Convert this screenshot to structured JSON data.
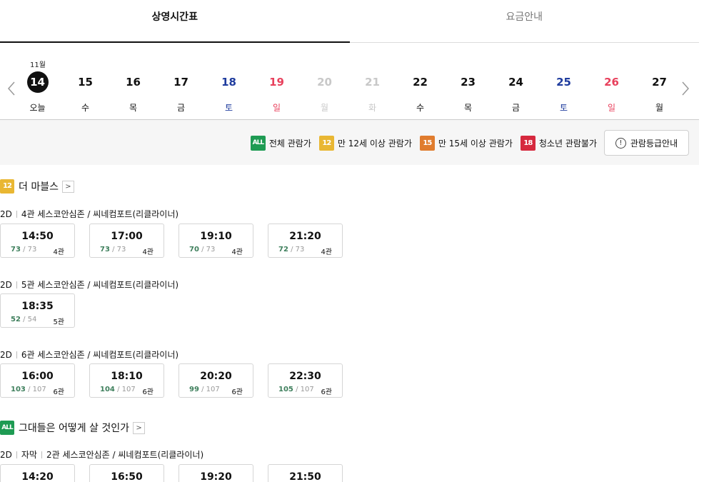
{
  "tabs": [
    {
      "label": "상영시간표",
      "active": true
    },
    {
      "label": "요금안내",
      "active": false
    }
  ],
  "calendar": {
    "month": "11월",
    "days": [
      {
        "num": "14",
        "weekday": "오늘",
        "type": "today"
      },
      {
        "num": "15",
        "weekday": "수",
        "type": "normal"
      },
      {
        "num": "16",
        "weekday": "목",
        "type": "normal"
      },
      {
        "num": "17",
        "weekday": "금",
        "type": "normal"
      },
      {
        "num": "18",
        "weekday": "토",
        "type": "sat"
      },
      {
        "num": "19",
        "weekday": "일",
        "type": "sun"
      },
      {
        "num": "20",
        "weekday": "월",
        "type": "dis"
      },
      {
        "num": "21",
        "weekday": "화",
        "type": "dis"
      },
      {
        "num": "22",
        "weekday": "수",
        "type": "normal"
      },
      {
        "num": "23",
        "weekday": "목",
        "type": "normal"
      },
      {
        "num": "24",
        "weekday": "금",
        "type": "normal"
      },
      {
        "num": "25",
        "weekday": "토",
        "type": "sat"
      },
      {
        "num": "26",
        "weekday": "일",
        "type": "sun"
      },
      {
        "num": "27",
        "weekday": "월",
        "type": "normal"
      }
    ]
  },
  "ratings": {
    "items": [
      {
        "badge": "ALL",
        "label": "전체 관람가",
        "color": "#1e9b53"
      },
      {
        "badge": "12",
        "label": "만 12세 이상 관람가",
        "color": "#e9b733"
      },
      {
        "badge": "15",
        "label": "만 15세 이상 관람가",
        "color": "#e07c2e"
      },
      {
        "badge": "18",
        "label": "청소년 관람불가",
        "color": "#d6293e"
      }
    ],
    "guide_button": "관람등급안내"
  },
  "movies": [
    {
      "title": "더 마블스",
      "rating": "12",
      "screens": [
        {
          "format": "2D",
          "info": "4관 세스코안심존 / 씨네컴포트(리클라이너)",
          "times": [
            {
              "time": "14:50",
              "avail": "73",
              "total": "/ 73",
              "hall": "4관"
            },
            {
              "time": "17:00",
              "avail": "73",
              "total": "/ 73",
              "hall": "4관"
            },
            {
              "time": "19:10",
              "avail": "70",
              "total": "/ 73",
              "hall": "4관"
            },
            {
              "time": "21:20",
              "avail": "72",
              "total": "/ 73",
              "hall": "4관"
            }
          ]
        },
        {
          "format": "2D",
          "info": "5관 세스코안심존 / 씨네컴포트(리클라이너)",
          "times": [
            {
              "time": "18:35",
              "avail": "52",
              "total": "/ 54",
              "hall": "5관"
            }
          ]
        },
        {
          "format": "2D",
          "info": "6관 세스코안심존 / 씨네컴포트(리클라이너)",
          "times": [
            {
              "time": "16:00",
              "avail": "103",
              "total": "/ 107",
              "hall": "6관"
            },
            {
              "time": "18:10",
              "avail": "104",
              "total": "/ 107",
              "hall": "6관"
            },
            {
              "time": "20:20",
              "avail": "99",
              "total": "/ 107",
              "hall": "6관"
            },
            {
              "time": "22:30",
              "avail": "105",
              "total": "/ 107",
              "hall": "6관"
            }
          ]
        }
      ]
    },
    {
      "title": "그대들은 어떻게 살 것인가",
      "rating": "ALL",
      "screens": [
        {
          "format": "2D",
          "subtitle": "자막",
          "info": "2관 세스코안심존 / 씨네컴포트(리클라이너)",
          "times": [
            {
              "time": "14:20"
            },
            {
              "time": "16:50"
            },
            {
              "time": "19:20"
            },
            {
              "time": "21:50"
            }
          ]
        }
      ]
    }
  ]
}
